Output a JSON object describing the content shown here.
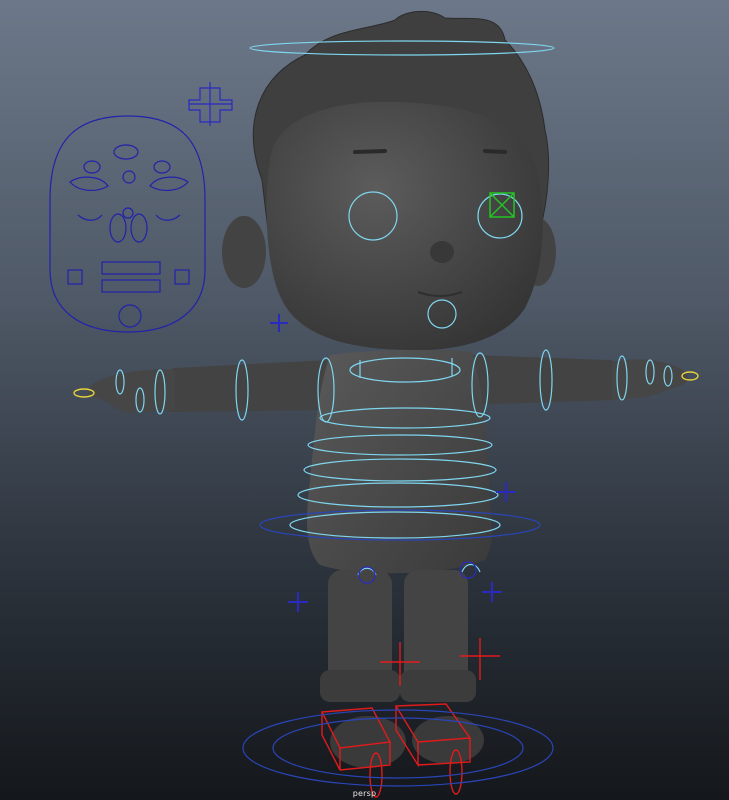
{
  "viewport": {
    "camera_label": "persp",
    "colors": {
      "mesh": "#4a4a4a",
      "mesh_dark": "#2f2f2f",
      "control_curve": "#7fd6ef",
      "face_panel": "#2222aa",
      "selected_control": "#23c423",
      "ik_control": "#e11b1b",
      "pivot": "#2a2ac2",
      "highlight": "#e6d23a"
    }
  }
}
